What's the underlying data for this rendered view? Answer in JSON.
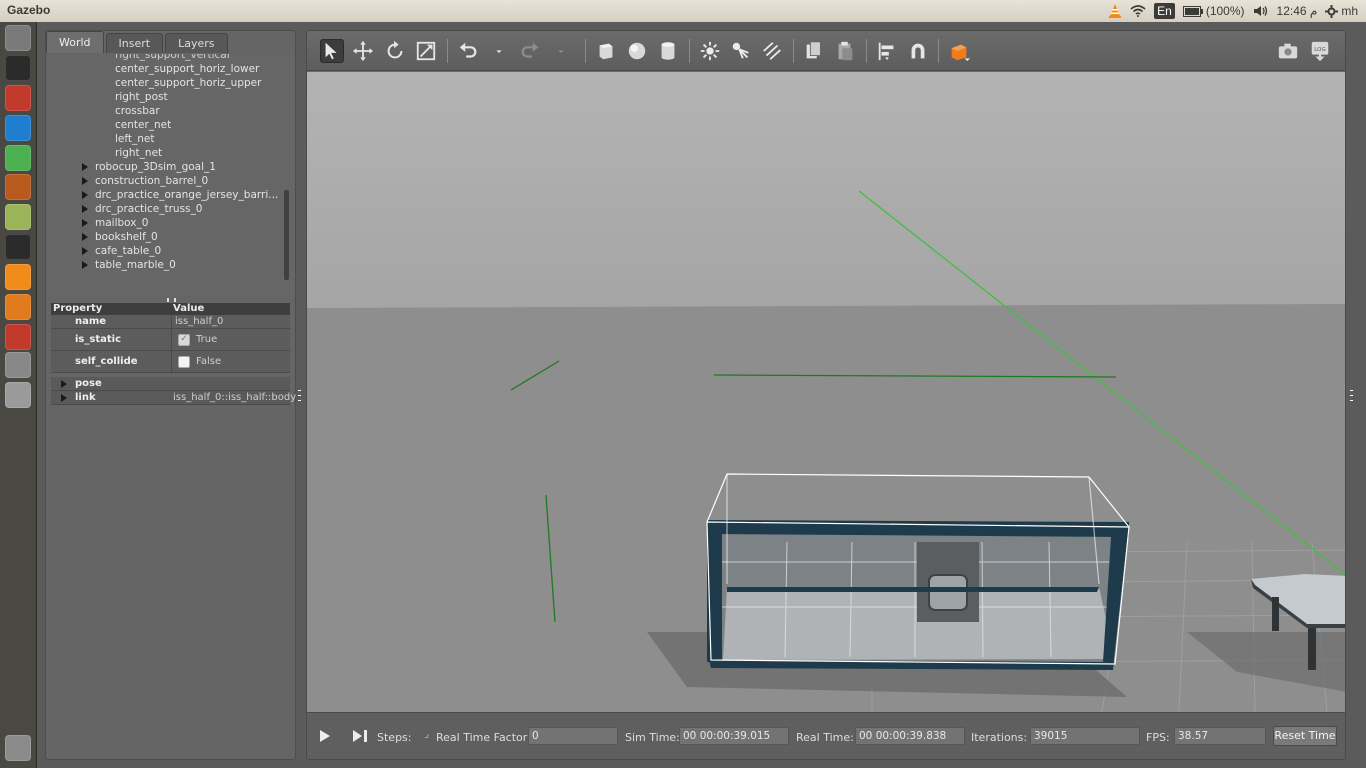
{
  "app": {
    "title": "Gazebo"
  },
  "tray": {
    "language": "En",
    "battery": "(100%)",
    "time": "12:46 م",
    "user": "mh"
  },
  "launcher": {
    "items": [
      {
        "icon": "ubuntu-dash-icon",
        "color": "#7a7a7a"
      },
      {
        "icon": "terminal-icon",
        "color": "#2b2b2b"
      },
      {
        "icon": "files-archive-icon",
        "color": "#c0392b"
      },
      {
        "icon": "vscode-icon",
        "color": "#1f7ecf"
      },
      {
        "icon": "chrome-icon",
        "color": "#4caf50"
      },
      {
        "icon": "slides-icon",
        "color": "#b85a1e"
      },
      {
        "icon": "image-viewer-icon",
        "color": "#9bb45a"
      },
      {
        "icon": "terminal-icon-2",
        "color": "#2b2b2b"
      },
      {
        "icon": "vlc-icon",
        "color": "#f08c1a"
      },
      {
        "icon": "gazebo-icon",
        "color": "#e07b1e"
      },
      {
        "icon": "installer-icon",
        "color": "#c0392b"
      },
      {
        "icon": "disk-icon",
        "color": "#888888"
      },
      {
        "icon": "drive-icon",
        "color": "#9a9a9a"
      },
      {
        "icon": "trash-icon",
        "color": "#8a8a8a"
      }
    ]
  },
  "left_panel": {
    "tabs": [
      {
        "label": "World",
        "active": true
      },
      {
        "label": "Insert",
        "active": false
      },
      {
        "label": "Layers",
        "active": false
      }
    ],
    "tree": {
      "partial_item": "right_support_vertical",
      "link_items": [
        "center_support_horiz_lower",
        "center_support_horiz_upper",
        "right_post",
        "crossbar",
        "center_net",
        "left_net",
        "right_net"
      ],
      "model_items": [
        "robocup_3Dsim_goal_1",
        "construction_barrel_0",
        "drc_practice_orange_jersey_barri...",
        "drc_practice_truss_0",
        "mailbox_0",
        "bookshelf_0",
        "cafe_table_0",
        "table_marble_0"
      ],
      "selected_item": "iss_half_0"
    },
    "properties": {
      "header_property": "Property",
      "header_value": "Value",
      "name_key": "name",
      "name_value": "iss_half_0",
      "is_static_key": "is_static",
      "is_static_value": "True",
      "self_collide_key": "self_collide",
      "self_collide_value": "False",
      "pose_label": "pose",
      "link_label": "link",
      "link_value": "iss_half_0::iss_half::body"
    }
  },
  "toolbar": {
    "tools": [
      "select-arrow-icon",
      "translate-icon",
      "rotate-icon",
      "scale-icon",
      "undo-icon",
      "undo-dropdown-icon",
      "redo-icon",
      "redo-dropdown-icon",
      "box-shape-icon",
      "sphere-shape-icon",
      "cylinder-shape-icon",
      "point-light-icon",
      "spot-light-icon",
      "directional-light-icon",
      "copy-icon",
      "paste-icon",
      "align-icon",
      "snap-icon",
      "view-angle-icon",
      "screenshot-icon",
      "log-icon"
    ],
    "active_tool": "select-arrow-icon"
  },
  "statusbar": {
    "steps_label": "Steps:",
    "rtf_label": "Real Time Factor:",
    "rtf_value": "0",
    "sim_time_label": "Sim Time:",
    "sim_time_value": "00 00:00:39.015",
    "real_time_label": "Real Time:",
    "real_time_value": "00 00:00:39.838",
    "iterations_label": "Iterations:",
    "iterations_value": "39015",
    "fps_label": "FPS:",
    "fps_value": "38.57",
    "reset_label": "Reset Time"
  },
  "colors": {
    "selected": "#f27b21",
    "sky": "#adadad",
    "ground": "#8f8f8f",
    "axis_green": "#1f7a1f"
  }
}
